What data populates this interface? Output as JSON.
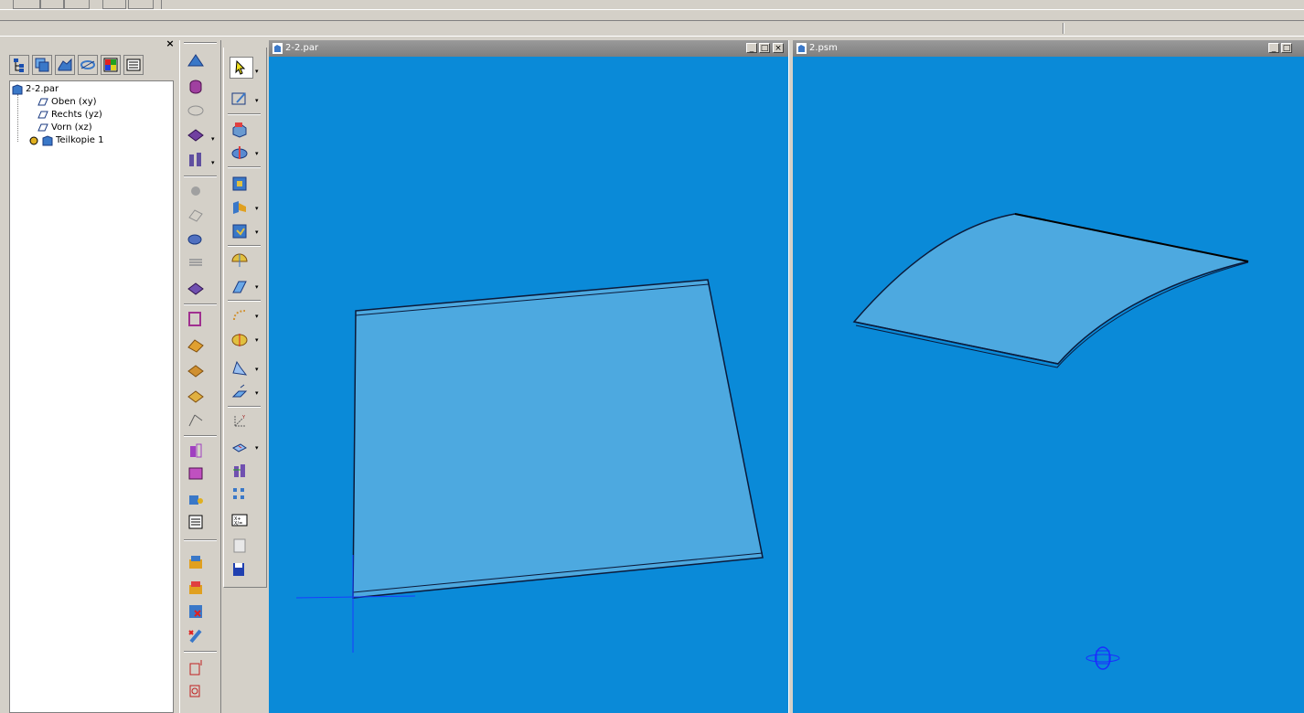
{
  "app": {
    "top_toolbar": {
      "buttons": [
        "tb-1",
        "tb-2",
        "tb-3",
        "tb-4",
        "tb-5"
      ]
    }
  },
  "left_pane": {
    "tabs": [
      {
        "name": "feature-tree-icon"
      },
      {
        "name": "layers-icon"
      },
      {
        "name": "parts-icon"
      },
      {
        "name": "sketch-icon"
      },
      {
        "name": "color-icon"
      },
      {
        "name": "properties-icon"
      }
    ],
    "tree": {
      "root": "2-2.par",
      "items": [
        {
          "label": "Oben (xy)",
          "icon": "plane-icon"
        },
        {
          "label": "Rechts (yz)",
          "icon": "plane-icon"
        },
        {
          "label": "Vorn (xz)",
          "icon": "plane-icon"
        },
        {
          "label": "Teilkopie 1",
          "icon": "part-copy-icon"
        }
      ]
    }
  },
  "windows": [
    {
      "title": "2-2.par",
      "controls": [
        "_",
        "□",
        "×"
      ],
      "background": "#0a8ad8"
    },
    {
      "title": "2.psm",
      "controls": [
        "_",
        "□"
      ],
      "background": "#0a8ad8"
    }
  ],
  "colors": {
    "viewport_bg": "#0a8ad8",
    "surface_fill": "#4da9e0",
    "edge": "#0b1a3a",
    "axis": "#1a3cff"
  }
}
